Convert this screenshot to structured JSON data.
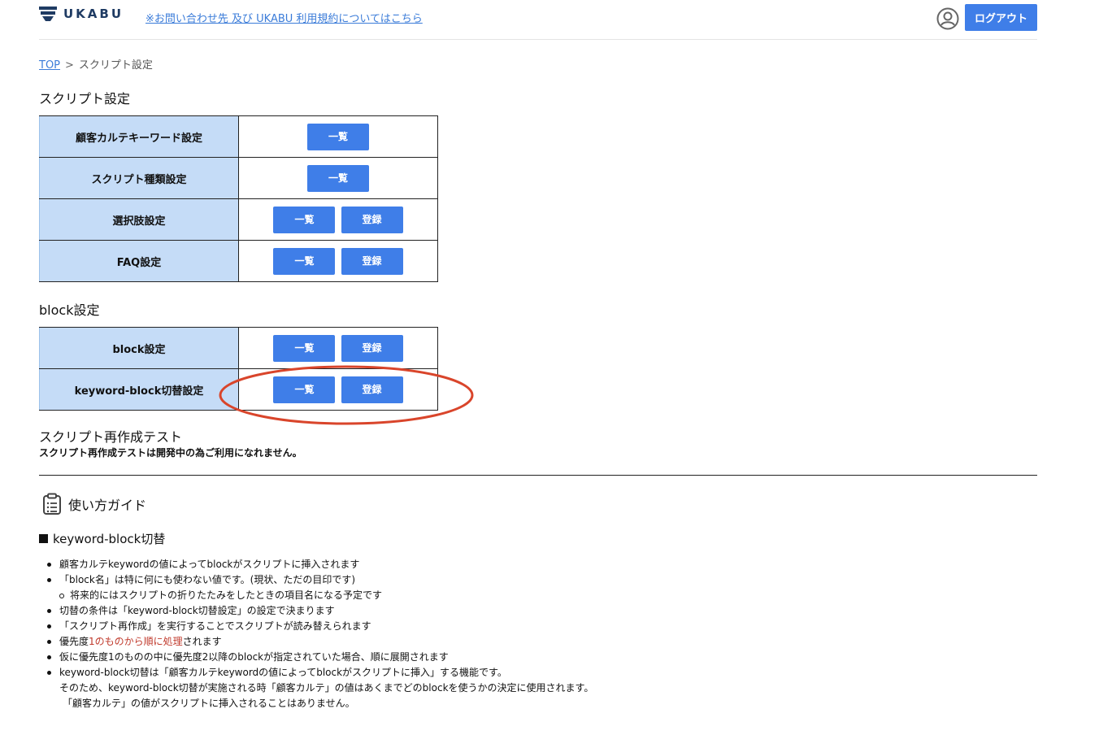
{
  "header": {
    "logo_text": "UKABU",
    "contact_link": "※お問い合わせ先 及び UKABU 利用規約についてはこちら",
    "logout_label": "ログアウト"
  },
  "breadcrumb": {
    "top": "TOP",
    "separator": ">",
    "current": "スクリプト設定"
  },
  "script_section": {
    "title": "スクリプト設定",
    "rows": [
      {
        "label": "顧客カルテキーワード設定",
        "list_label": "一覧"
      },
      {
        "label": "スクリプト種類設定",
        "list_label": "一覧"
      },
      {
        "label": "選択肢設定",
        "list_label": "一覧",
        "register_label": "登録"
      },
      {
        "label": "FAQ設定",
        "list_label": "一覧",
        "register_label": "登録"
      }
    ]
  },
  "block_section": {
    "title": "block設定",
    "rows": [
      {
        "label": "block設定",
        "list_label": "一覧",
        "register_label": "登録"
      },
      {
        "label": "keyword-block切替設定",
        "list_label": "一覧",
        "register_label": "登録"
      }
    ]
  },
  "regen": {
    "title": "スクリプト再作成テスト",
    "note": "スクリプト再作成テストは開発中の為ご利用になれません。"
  },
  "guide": {
    "title": "使い方ガイド",
    "subtitle": "keyword-block切替",
    "items": {
      "i1": "顧客カルテkeywordの値によってblockがスクリプトに挿入されます",
      "i2": "「block名」は特に何にも使わない値です。(現状、ただの目印です)",
      "i2_sub": "将来的にはスクリプトの折りたたみをしたときの項目名になる予定です",
      "i3": "切替の条件は「keyword-block切替設定」の設定で決まります",
      "i4": "「スクリプト再作成」を実行することでスクリプトが読み替えられます",
      "i5_pre": "優先度",
      "i5_red": "1のものから順に処理",
      "i5_post": "されます",
      "i6": "仮に優先度1のものの中に優先度2以降のblockが指定されていた場合、順に展開されます",
      "i7": "keyword-block切替は「顧客カルテkeywordの値によってblockがスクリプトに挿入」する機能です。",
      "i7_line2": "そのため、keyword-block切替が実施される時「顧客カルテ」の値はあくまでどのblockを使うかの決定に使用されます。",
      "i7_line3": "「顧客カルテ」の値がスクリプトに挿入されることはありません。"
    }
  },
  "colors": {
    "accent": "#3f7ee8",
    "label_bg": "#c5dcf7",
    "highlight": "#d9452b",
    "emphasis": "#c0392b"
  },
  "icons": {
    "logo": "ukabu-logo-icon",
    "user": "user-circle-icon",
    "guide": "clipboard-icon"
  }
}
